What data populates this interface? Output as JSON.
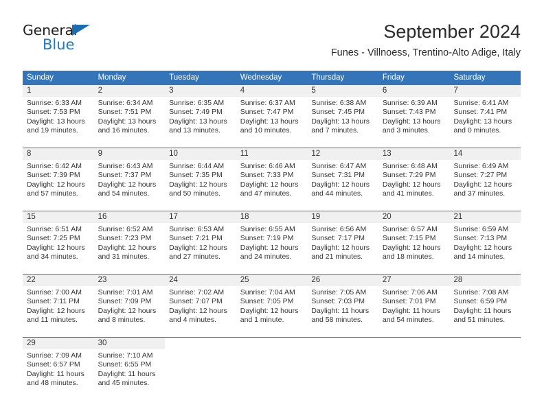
{
  "brand": {
    "name_part1": "General",
    "name_part2": "Blue",
    "accent_color": "#2079c4",
    "triangle_color": "#1b6cb0"
  },
  "header": {
    "month_title": "September 2024",
    "location": "Funes - Villnoess, Trentino-Alto Adige, Italy"
  },
  "theme": {
    "header_blue": "#3375b8",
    "daynum_band": "#f0f0f0",
    "text": "#333333"
  },
  "calendar": {
    "weekday_headers": [
      "Sunday",
      "Monday",
      "Tuesday",
      "Wednesday",
      "Thursday",
      "Friday",
      "Saturday"
    ],
    "weeks": [
      [
        {
          "day": "1",
          "sunrise": "Sunrise: 6:33 AM",
          "sunset": "Sunset: 7:53 PM",
          "daylight1": "Daylight: 13 hours",
          "daylight2": "and 19 minutes."
        },
        {
          "day": "2",
          "sunrise": "Sunrise: 6:34 AM",
          "sunset": "Sunset: 7:51 PM",
          "daylight1": "Daylight: 13 hours",
          "daylight2": "and 16 minutes."
        },
        {
          "day": "3",
          "sunrise": "Sunrise: 6:35 AM",
          "sunset": "Sunset: 7:49 PM",
          "daylight1": "Daylight: 13 hours",
          "daylight2": "and 13 minutes."
        },
        {
          "day": "4",
          "sunrise": "Sunrise: 6:37 AM",
          "sunset": "Sunset: 7:47 PM",
          "daylight1": "Daylight: 13 hours",
          "daylight2": "and 10 minutes."
        },
        {
          "day": "5",
          "sunrise": "Sunrise: 6:38 AM",
          "sunset": "Sunset: 7:45 PM",
          "daylight1": "Daylight: 13 hours",
          "daylight2": "and 7 minutes."
        },
        {
          "day": "6",
          "sunrise": "Sunrise: 6:39 AM",
          "sunset": "Sunset: 7:43 PM",
          "daylight1": "Daylight: 13 hours",
          "daylight2": "and 3 minutes."
        },
        {
          "day": "7",
          "sunrise": "Sunrise: 6:41 AM",
          "sunset": "Sunset: 7:41 PM",
          "daylight1": "Daylight: 13 hours",
          "daylight2": "and 0 minutes."
        }
      ],
      [
        {
          "day": "8",
          "sunrise": "Sunrise: 6:42 AM",
          "sunset": "Sunset: 7:39 PM",
          "daylight1": "Daylight: 12 hours",
          "daylight2": "and 57 minutes."
        },
        {
          "day": "9",
          "sunrise": "Sunrise: 6:43 AM",
          "sunset": "Sunset: 7:37 PM",
          "daylight1": "Daylight: 12 hours",
          "daylight2": "and 54 minutes."
        },
        {
          "day": "10",
          "sunrise": "Sunrise: 6:44 AM",
          "sunset": "Sunset: 7:35 PM",
          "daylight1": "Daylight: 12 hours",
          "daylight2": "and 50 minutes."
        },
        {
          "day": "11",
          "sunrise": "Sunrise: 6:46 AM",
          "sunset": "Sunset: 7:33 PM",
          "daylight1": "Daylight: 12 hours",
          "daylight2": "and 47 minutes."
        },
        {
          "day": "12",
          "sunrise": "Sunrise: 6:47 AM",
          "sunset": "Sunset: 7:31 PM",
          "daylight1": "Daylight: 12 hours",
          "daylight2": "and 44 minutes."
        },
        {
          "day": "13",
          "sunrise": "Sunrise: 6:48 AM",
          "sunset": "Sunset: 7:29 PM",
          "daylight1": "Daylight: 12 hours",
          "daylight2": "and 41 minutes."
        },
        {
          "day": "14",
          "sunrise": "Sunrise: 6:49 AM",
          "sunset": "Sunset: 7:27 PM",
          "daylight1": "Daylight: 12 hours",
          "daylight2": "and 37 minutes."
        }
      ],
      [
        {
          "day": "15",
          "sunrise": "Sunrise: 6:51 AM",
          "sunset": "Sunset: 7:25 PM",
          "daylight1": "Daylight: 12 hours",
          "daylight2": "and 34 minutes."
        },
        {
          "day": "16",
          "sunrise": "Sunrise: 6:52 AM",
          "sunset": "Sunset: 7:23 PM",
          "daylight1": "Daylight: 12 hours",
          "daylight2": "and 31 minutes."
        },
        {
          "day": "17",
          "sunrise": "Sunrise: 6:53 AM",
          "sunset": "Sunset: 7:21 PM",
          "daylight1": "Daylight: 12 hours",
          "daylight2": "and 27 minutes."
        },
        {
          "day": "18",
          "sunrise": "Sunrise: 6:55 AM",
          "sunset": "Sunset: 7:19 PM",
          "daylight1": "Daylight: 12 hours",
          "daylight2": "and 24 minutes."
        },
        {
          "day": "19",
          "sunrise": "Sunrise: 6:56 AM",
          "sunset": "Sunset: 7:17 PM",
          "daylight1": "Daylight: 12 hours",
          "daylight2": "and 21 minutes."
        },
        {
          "day": "20",
          "sunrise": "Sunrise: 6:57 AM",
          "sunset": "Sunset: 7:15 PM",
          "daylight1": "Daylight: 12 hours",
          "daylight2": "and 18 minutes."
        },
        {
          "day": "21",
          "sunrise": "Sunrise: 6:59 AM",
          "sunset": "Sunset: 7:13 PM",
          "daylight1": "Daylight: 12 hours",
          "daylight2": "and 14 minutes."
        }
      ],
      [
        {
          "day": "22",
          "sunrise": "Sunrise: 7:00 AM",
          "sunset": "Sunset: 7:11 PM",
          "daylight1": "Daylight: 12 hours",
          "daylight2": "and 11 minutes."
        },
        {
          "day": "23",
          "sunrise": "Sunrise: 7:01 AM",
          "sunset": "Sunset: 7:09 PM",
          "daylight1": "Daylight: 12 hours",
          "daylight2": "and 8 minutes."
        },
        {
          "day": "24",
          "sunrise": "Sunrise: 7:02 AM",
          "sunset": "Sunset: 7:07 PM",
          "daylight1": "Daylight: 12 hours",
          "daylight2": "and 4 minutes."
        },
        {
          "day": "25",
          "sunrise": "Sunrise: 7:04 AM",
          "sunset": "Sunset: 7:05 PM",
          "daylight1": "Daylight: 12 hours",
          "daylight2": "and 1 minute."
        },
        {
          "day": "26",
          "sunrise": "Sunrise: 7:05 AM",
          "sunset": "Sunset: 7:03 PM",
          "daylight1": "Daylight: 11 hours",
          "daylight2": "and 58 minutes."
        },
        {
          "day": "27",
          "sunrise": "Sunrise: 7:06 AM",
          "sunset": "Sunset: 7:01 PM",
          "daylight1": "Daylight: 11 hours",
          "daylight2": "and 54 minutes."
        },
        {
          "day": "28",
          "sunrise": "Sunrise: 7:08 AM",
          "sunset": "Sunset: 6:59 PM",
          "daylight1": "Daylight: 11 hours",
          "daylight2": "and 51 minutes."
        }
      ],
      [
        {
          "day": "29",
          "sunrise": "Sunrise: 7:09 AM",
          "sunset": "Sunset: 6:57 PM",
          "daylight1": "Daylight: 11 hours",
          "daylight2": "and 48 minutes."
        },
        {
          "day": "30",
          "sunrise": "Sunrise: 7:10 AM",
          "sunset": "Sunset: 6:55 PM",
          "daylight1": "Daylight: 11 hours",
          "daylight2": "and 45 minutes."
        },
        {
          "day": "",
          "sunrise": "",
          "sunset": "",
          "daylight1": "",
          "daylight2": ""
        },
        {
          "day": "",
          "sunrise": "",
          "sunset": "",
          "daylight1": "",
          "daylight2": ""
        },
        {
          "day": "",
          "sunrise": "",
          "sunset": "",
          "daylight1": "",
          "daylight2": ""
        },
        {
          "day": "",
          "sunrise": "",
          "sunset": "",
          "daylight1": "",
          "daylight2": ""
        },
        {
          "day": "",
          "sunrise": "",
          "sunset": "",
          "daylight1": "",
          "daylight2": ""
        }
      ]
    ]
  }
}
